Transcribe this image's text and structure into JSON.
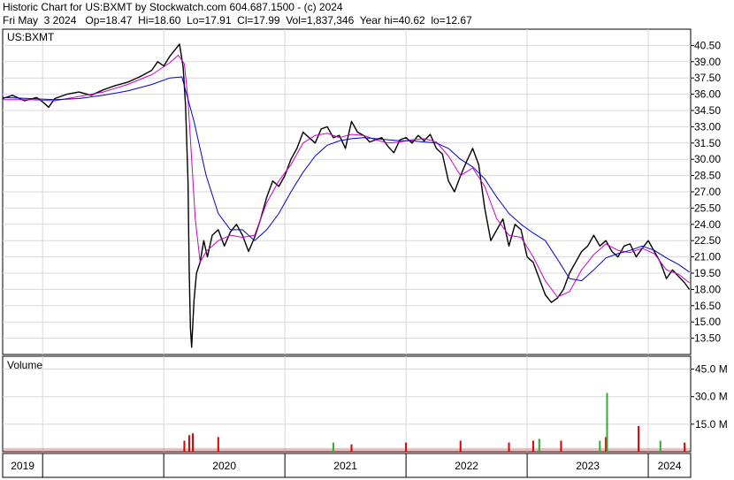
{
  "header": {
    "line1": "Historic Chart for US:BXMT by Stockwatch.com 604.687.1500 - (c) 2024",
    "line2": "Fri May  3 2024   Op=18.47  Hi=18.60  Lo=17.91  Cl=17.99  Vol=1,837,346  Year hi=40.62  lo=12.67"
  },
  "colors": {
    "price": "#000000",
    "ma_short": "#cc00cc",
    "ma_long": "#0000cc",
    "grid": "#d8d8d8",
    "vol_up": "#33aa33",
    "vol_down": "#dd0000"
  },
  "chart_data": [
    {
      "type": "line",
      "title": "US:BXMT",
      "ylim": [
        12.0,
        42.0
      ],
      "y_ticks": [
        "40.50",
        "39.00",
        "37.50",
        "36.00",
        "34.50",
        "33.00",
        "31.50",
        "30.00",
        "28.50",
        "27.00",
        "25.50",
        "24.00",
        "22.50",
        "21.00",
        "19.50",
        "18.00",
        "16.50",
        "15.00",
        "13.50"
      ],
      "x_ticks": [
        "2019",
        "2020",
        "2021",
        "2022",
        "2023",
        "2024"
      ],
      "x_tick_dates": [
        2019.0,
        2020.0,
        2021.0,
        2022.0,
        2023.0,
        2024.0
      ],
      "xlim": [
        2018.67,
        2024.35
      ],
      "series": [
        {
          "role": "price",
          "x": [
            2018.67,
            2018.75,
            2018.85,
            2018.95,
            2019.0,
            2019.05,
            2019.1,
            2019.2,
            2019.3,
            2019.4,
            2019.5,
            2019.6,
            2019.7,
            2019.8,
            2019.9,
            2019.95,
            2020.0,
            2020.05,
            2020.1,
            2020.13,
            2020.16,
            2020.18,
            2020.2,
            2020.21,
            2020.22,
            2020.23,
            2020.25,
            2020.27,
            2020.3,
            2020.33,
            2020.36,
            2020.4,
            2020.45,
            2020.5,
            2020.55,
            2020.6,
            2020.65,
            2020.7,
            2020.75,
            2020.8,
            2020.85,
            2020.9,
            2020.95,
            2021.0,
            2021.05,
            2021.1,
            2021.15,
            2021.2,
            2021.25,
            2021.3,
            2021.35,
            2021.4,
            2021.45,
            2021.5,
            2021.55,
            2021.6,
            2021.65,
            2021.7,
            2021.75,
            2021.8,
            2021.85,
            2021.9,
            2021.95,
            2022.0,
            2022.05,
            2022.1,
            2022.15,
            2022.2,
            2022.25,
            2022.3,
            2022.35,
            2022.4,
            2022.45,
            2022.5,
            2022.55,
            2022.6,
            2022.65,
            2022.7,
            2022.75,
            2022.8,
            2022.85,
            2022.9,
            2022.95,
            2023.0,
            2023.05,
            2023.1,
            2023.15,
            2023.2,
            2023.25,
            2023.3,
            2023.35,
            2023.4,
            2023.45,
            2023.5,
            2023.55,
            2023.6,
            2023.65,
            2023.7,
            2023.75,
            2023.8,
            2023.85,
            2023.9,
            2023.95,
            2024.0,
            2024.05,
            2024.1,
            2024.15,
            2024.2,
            2024.25,
            2024.3,
            2024.34
          ],
          "values": [
            35.6,
            35.9,
            35.4,
            35.7,
            35.3,
            34.8,
            35.6,
            36.0,
            36.2,
            35.9,
            36.4,
            36.8,
            37.1,
            37.6,
            38.2,
            39.0,
            38.6,
            39.5,
            40.2,
            40.62,
            38.5,
            35.0,
            28.0,
            20.0,
            14.5,
            12.67,
            17.0,
            19.5,
            20.5,
            22.5,
            21.0,
            23.0,
            23.5,
            22.0,
            23.3,
            24.0,
            23.0,
            21.5,
            22.8,
            24.5,
            26.5,
            28.0,
            27.5,
            28.5,
            30.0,
            31.0,
            32.5,
            32.0,
            31.5,
            32.8,
            33.0,
            32.0,
            32.2,
            31.0,
            33.5,
            32.5,
            32.2,
            31.6,
            31.8,
            32.0,
            31.2,
            30.6,
            31.8,
            32.0,
            31.5,
            32.2,
            31.7,
            32.3,
            31.0,
            30.5,
            28.0,
            27.0,
            28.5,
            29.8,
            31.0,
            29.5,
            25.5,
            22.5,
            23.5,
            24.5,
            22.0,
            24.0,
            23.5,
            21.0,
            20.5,
            19.0,
            17.5,
            16.8,
            17.2,
            18.0,
            19.5,
            20.5,
            21.5,
            22.0,
            23.0,
            22.0,
            22.5,
            21.5,
            21.0,
            22.0,
            22.2,
            21.0,
            21.8,
            22.5,
            21.5,
            20.5,
            19.0,
            19.8,
            19.2,
            18.6,
            17.99
          ]
        },
        {
          "role": "ma_short",
          "name": "",
          "x": [
            2018.67,
            2018.9,
            2019.1,
            2019.3,
            2019.5,
            2019.7,
            2019.9,
            2020.05,
            2020.12,
            2020.17,
            2020.2,
            2020.23,
            2020.26,
            2020.3,
            2020.35,
            2020.45,
            2020.55,
            2020.65,
            2020.75,
            2020.85,
            2020.95,
            2021.05,
            2021.15,
            2021.25,
            2021.35,
            2021.45,
            2021.55,
            2021.65,
            2021.75,
            2021.85,
            2021.95,
            2022.05,
            2022.15,
            2022.25,
            2022.35,
            2022.45,
            2022.55,
            2022.65,
            2022.75,
            2022.85,
            2022.95,
            2023.05,
            2023.15,
            2023.25,
            2023.35,
            2023.45,
            2023.55,
            2023.65,
            2023.75,
            2023.85,
            2023.95,
            2024.05,
            2024.15,
            2024.25,
            2024.34
          ],
          "values": [
            35.5,
            35.5,
            35.4,
            35.8,
            36.2,
            36.9,
            37.8,
            38.9,
            39.6,
            38.8,
            35.5,
            30.0,
            24.5,
            20.5,
            21.5,
            22.5,
            23.0,
            22.8,
            23.0,
            26.0,
            28.0,
            29.5,
            31.5,
            32.2,
            32.4,
            32.0,
            32.3,
            32.2,
            31.8,
            31.5,
            31.6,
            31.8,
            31.9,
            31.6,
            30.3,
            28.5,
            29.2,
            27.5,
            24.5,
            23.0,
            22.8,
            21.0,
            18.8,
            17.3,
            17.8,
            19.8,
            21.2,
            22.2,
            21.6,
            21.4,
            21.8,
            21.3,
            19.8,
            19.4,
            18.6
          ]
        },
        {
          "role": "ma_long",
          "name": "",
          "x": [
            2018.67,
            2018.9,
            2019.1,
            2019.3,
            2019.5,
            2019.7,
            2019.9,
            2020.05,
            2020.15,
            2020.25,
            2020.35,
            2020.45,
            2020.55,
            2020.65,
            2020.75,
            2020.85,
            2020.95,
            2021.05,
            2021.15,
            2021.25,
            2021.35,
            2021.45,
            2021.55,
            2021.65,
            2021.75,
            2021.85,
            2021.95,
            2022.05,
            2022.15,
            2022.25,
            2022.35,
            2022.45,
            2022.55,
            2022.65,
            2022.75,
            2022.85,
            2022.95,
            2023.05,
            2023.15,
            2023.25,
            2023.35,
            2023.45,
            2023.55,
            2023.65,
            2023.75,
            2023.85,
            2023.95,
            2024.05,
            2024.15,
            2024.25,
            2024.34
          ],
          "values": [
            35.7,
            35.6,
            35.5,
            35.6,
            35.9,
            36.3,
            36.9,
            37.5,
            37.6,
            33.5,
            28.5,
            25.0,
            23.5,
            23.5,
            22.5,
            23.5,
            25.0,
            27.0,
            28.8,
            30.3,
            31.3,
            31.7,
            31.9,
            32.0,
            31.9,
            31.8,
            31.7,
            31.7,
            31.6,
            31.5,
            31.0,
            30.0,
            29.3,
            28.2,
            26.5,
            25.0,
            24.0,
            23.2,
            22.5,
            20.8,
            19.0,
            18.8,
            19.8,
            20.9,
            21.3,
            21.6,
            22.0,
            21.6,
            20.9,
            20.3,
            19.6
          ]
        }
      ]
    },
    {
      "type": "bar",
      "title": "Volume",
      "ylim": [
        0,
        52
      ],
      "y_ticks": [
        "45.0 M",
        "30.0 M",
        "15.0 M"
      ],
      "y_tick_values": [
        45,
        30,
        15
      ],
      "x": [
        2020.17,
        2020.21,
        2020.24,
        2020.45,
        2021.4,
        2021.55,
        2022.0,
        2022.45,
        2022.85,
        2023.05,
        2023.1,
        2023.28,
        2023.6,
        2023.65,
        2023.66,
        2023.92,
        2024.1,
        2024.3
      ],
      "values": [
        6,
        9,
        10,
        8,
        5,
        4,
        5,
        6,
        5,
        6,
        7,
        6,
        6,
        8,
        32,
        14,
        6,
        5
      ],
      "colors": [
        "down",
        "down",
        "down",
        "down",
        "up",
        "down",
        "down",
        "down",
        "down",
        "down",
        "up",
        "down",
        "up",
        "down",
        "up",
        "down",
        "up",
        "down"
      ]
    }
  ]
}
